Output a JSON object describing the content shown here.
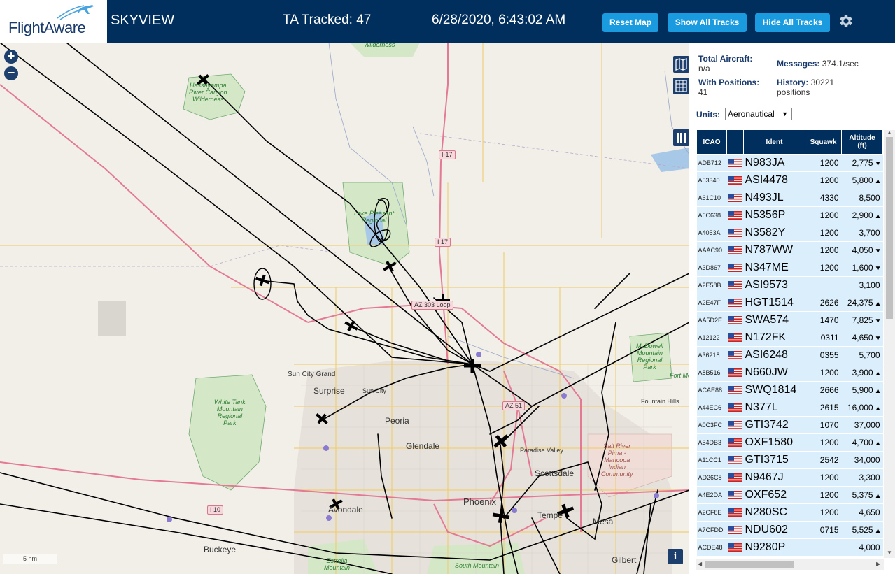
{
  "header": {
    "logo_text": "FlightAware",
    "app_title": "SKYVIEW",
    "tracked_label": "TA Tracked: 47",
    "datetime": "6/28/2020, 6:43:02 AM",
    "reset_map": "Reset Map",
    "show_all_tracks": "Show All Tracks",
    "hide_all_tracks": "Hide All Tracks"
  },
  "map": {
    "zoom_in": "+",
    "zoom_out": "−",
    "scale": "5 nm",
    "info": "i",
    "labels": {
      "surprise": "Surprise",
      "sun_city_grand": "Sun City Grand",
      "sun_city": "Sun City",
      "peoria": "Peoria",
      "glendale": "Glendale",
      "phoenix": "Phoenix",
      "avondale": "Avondale",
      "buckeye": "Buckeye",
      "scottsdale": "Scottsdale",
      "paradise_valley": "Paradise Valley",
      "tempe": "Tempe",
      "mesa": "Mesa",
      "gilbert": "Gilbert",
      "fountain_hills": "Fountain Hills",
      "fort_mc": "Fort Mc"
    },
    "parks": {
      "wilderness_top": "Wilderness",
      "hassayampa": "Hassayampa\nRiver Canyon\nWilderness",
      "lake_pleasant": "Lake Pleasant\nRegional",
      "white_tank": "White Tank\nMountain\nRegional\nPark",
      "mcdowell": "McDowell\nMountain\nRegional\nPark",
      "salt_river": "Salt River\nPima -\nMaricopa\nIndian\nCommunity",
      "estrella": "Estrella\nMountain",
      "south_mountain": "South Mountain"
    },
    "highways": {
      "i17_north": "I-17",
      "i17": "I 17",
      "az303": "AZ 303 Loop",
      "az51": "AZ 51",
      "i10": "I 10"
    }
  },
  "panel": {
    "total_aircraft_label": "Total Aircraft:",
    "total_aircraft_value": "n/a",
    "with_positions_label": "With Positions:",
    "with_positions_value": "41",
    "messages_label": "Messages:",
    "messages_value": "374.1/sec",
    "history_label": "History:",
    "history_value": "30221",
    "history_unit": "positions",
    "units_label": "Units:",
    "units_value": "Aeronautical",
    "columns": {
      "icao": "ICAO",
      "ident": "Ident",
      "squawk": "Squawk",
      "altitude": "Altitude\n(ft)"
    },
    "rows": [
      {
        "icao": "ADB712",
        "ident": "N983JA",
        "squawk": "1200",
        "alt": "2,775",
        "trend": "▼"
      },
      {
        "icao": "A53340",
        "ident": "ASI4478",
        "squawk": "1200",
        "alt": "5,800",
        "trend": "▲"
      },
      {
        "icao": "A61C10",
        "ident": "N493JL",
        "squawk": "4330",
        "alt": "8,500",
        "trend": ""
      },
      {
        "icao": "A6C638",
        "ident": "N5356P",
        "squawk": "1200",
        "alt": "2,900",
        "trend": "▲"
      },
      {
        "icao": "A4053A",
        "ident": "N3582Y",
        "squawk": "1200",
        "alt": "3,700",
        "trend": ""
      },
      {
        "icao": "AAAC90",
        "ident": "N787WW",
        "squawk": "1200",
        "alt": "4,050",
        "trend": "▼"
      },
      {
        "icao": "A3D867",
        "ident": "N347ME",
        "squawk": "1200",
        "alt": "1,600",
        "trend": "▼"
      },
      {
        "icao": "A2E58B",
        "ident": "ASI9573",
        "squawk": "",
        "alt": "3,100",
        "trend": ""
      },
      {
        "icao": "A2E47F",
        "ident": "HGT1514",
        "squawk": "2626",
        "alt": "24,375",
        "trend": "▲"
      },
      {
        "icao": "AA5D2E",
        "ident": "SWA574",
        "squawk": "1470",
        "alt": "7,825",
        "trend": "▼"
      },
      {
        "icao": "A12122",
        "ident": "N172FK",
        "squawk": "0311",
        "alt": "4,650",
        "trend": "▼"
      },
      {
        "icao": "A36218",
        "ident": "ASI6248",
        "squawk": "0355",
        "alt": "5,700",
        "trend": ""
      },
      {
        "icao": "A8B516",
        "ident": "N660JW",
        "squawk": "1200",
        "alt": "3,900",
        "trend": "▲"
      },
      {
        "icao": "ACAE88",
        "ident": "SWQ1814",
        "squawk": "2666",
        "alt": "5,900",
        "trend": "▲"
      },
      {
        "icao": "A44EC6",
        "ident": "N377L",
        "squawk": "2615",
        "alt": "16,000",
        "trend": "▲"
      },
      {
        "icao": "A0C3FC",
        "ident": "GTI3742",
        "squawk": "1070",
        "alt": "37,000",
        "trend": ""
      },
      {
        "icao": "A54DB3",
        "ident": "OXF1580",
        "squawk": "1200",
        "alt": "4,700",
        "trend": "▲"
      },
      {
        "icao": "A11CC1",
        "ident": "GTI3715",
        "squawk": "2542",
        "alt": "34,000",
        "trend": ""
      },
      {
        "icao": "AD26C8",
        "ident": "N9467J",
        "squawk": "1200",
        "alt": "3,300",
        "trend": ""
      },
      {
        "icao": "A4E2DA",
        "ident": "OXF652",
        "squawk": "1200",
        "alt": "5,375",
        "trend": "▲"
      },
      {
        "icao": "A2CF8E",
        "ident": "N280SC",
        "squawk": "1200",
        "alt": "4,650",
        "trend": ""
      },
      {
        "icao": "A7CFDD",
        "ident": "NDU602",
        "squawk": "0715",
        "alt": "5,525",
        "trend": "▲"
      },
      {
        "icao": "ACDE48",
        "ident": "N9280P",
        "squawk": "",
        "alt": "4,000",
        "trend": ""
      }
    ]
  }
}
